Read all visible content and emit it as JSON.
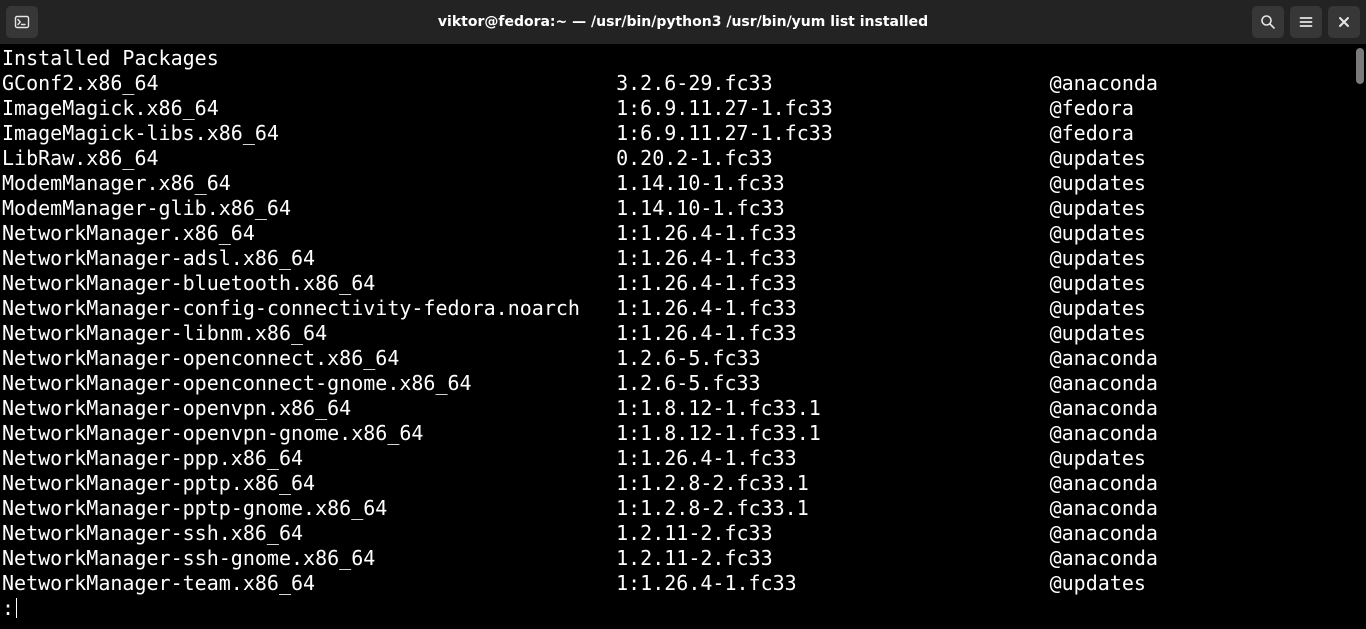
{
  "title": "viktor@fedora:~ — /usr/bin/python3 /usr/bin/yum list installed",
  "header_line": "Installed Packages",
  "packages": [
    {
      "name": "GConf2.x86_64",
      "version": "3.2.6-29.fc33",
      "repo": "@anaconda"
    },
    {
      "name": "ImageMagick.x86_64",
      "version": "1:6.9.11.27-1.fc33",
      "repo": "@fedora"
    },
    {
      "name": "ImageMagick-libs.x86_64",
      "version": "1:6.9.11.27-1.fc33",
      "repo": "@fedora"
    },
    {
      "name": "LibRaw.x86_64",
      "version": "0.20.2-1.fc33",
      "repo": "@updates"
    },
    {
      "name": "ModemManager.x86_64",
      "version": "1.14.10-1.fc33",
      "repo": "@updates"
    },
    {
      "name": "ModemManager-glib.x86_64",
      "version": "1.14.10-1.fc33",
      "repo": "@updates"
    },
    {
      "name": "NetworkManager.x86_64",
      "version": "1:1.26.4-1.fc33",
      "repo": "@updates"
    },
    {
      "name": "NetworkManager-adsl.x86_64",
      "version": "1:1.26.4-1.fc33",
      "repo": "@updates"
    },
    {
      "name": "NetworkManager-bluetooth.x86_64",
      "version": "1:1.26.4-1.fc33",
      "repo": "@updates"
    },
    {
      "name": "NetworkManager-config-connectivity-fedora.noarch",
      "version": "1:1.26.4-1.fc33",
      "repo": "@updates"
    },
    {
      "name": "NetworkManager-libnm.x86_64",
      "version": "1:1.26.4-1.fc33",
      "repo": "@updates"
    },
    {
      "name": "NetworkManager-openconnect.x86_64",
      "version": "1.2.6-5.fc33",
      "repo": "@anaconda"
    },
    {
      "name": "NetworkManager-openconnect-gnome.x86_64",
      "version": "1.2.6-5.fc33",
      "repo": "@anaconda"
    },
    {
      "name": "NetworkManager-openvpn.x86_64",
      "version": "1:1.8.12-1.fc33.1",
      "repo": "@anaconda"
    },
    {
      "name": "NetworkManager-openvpn-gnome.x86_64",
      "version": "1:1.8.12-1.fc33.1",
      "repo": "@anaconda"
    },
    {
      "name": "NetworkManager-ppp.x86_64",
      "version": "1:1.26.4-1.fc33",
      "repo": "@updates"
    },
    {
      "name": "NetworkManager-pptp.x86_64",
      "version": "1:1.2.8-2.fc33.1",
      "repo": "@anaconda"
    },
    {
      "name": "NetworkManager-pptp-gnome.x86_64",
      "version": "1:1.2.8-2.fc33.1",
      "repo": "@anaconda"
    },
    {
      "name": "NetworkManager-ssh.x86_64",
      "version": "1.2.11-2.fc33",
      "repo": "@anaconda"
    },
    {
      "name": "NetworkManager-ssh-gnome.x86_64",
      "version": "1.2.11-2.fc33",
      "repo": "@anaconda"
    },
    {
      "name": "NetworkManager-team.x86_64",
      "version": "1:1.26.4-1.fc33",
      "repo": "@updates"
    }
  ],
  "columns": {
    "name_width": 51,
    "version_width": 36
  },
  "pager_prompt": ":"
}
